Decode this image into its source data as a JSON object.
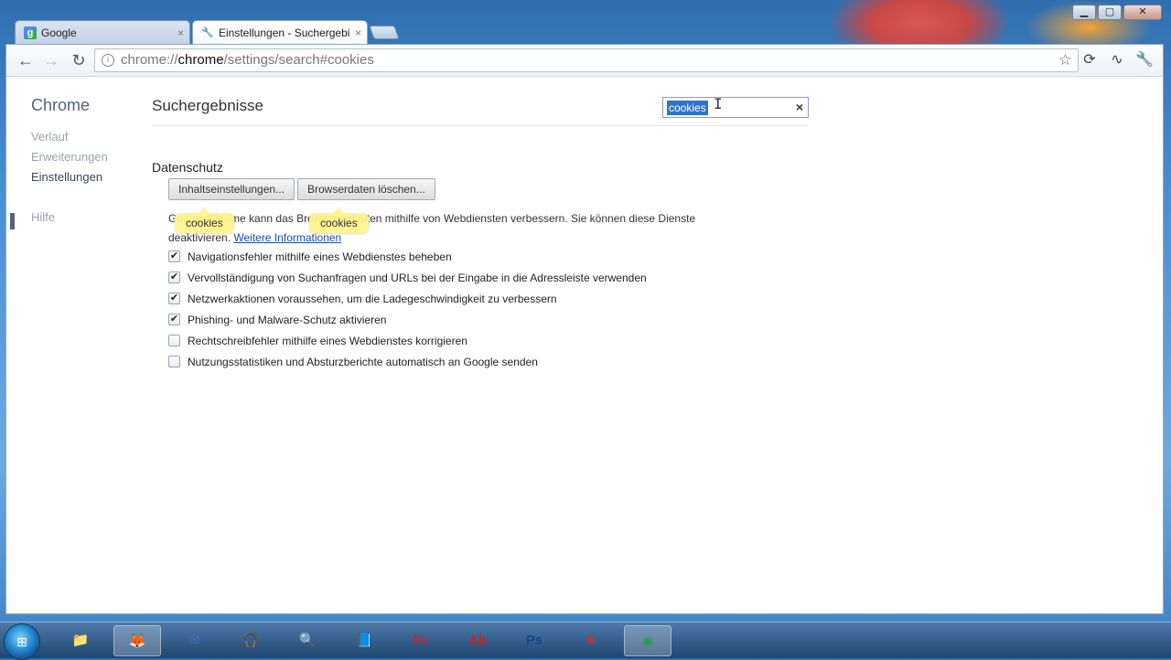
{
  "window": {
    "controls": {
      "minimize": "▁",
      "maximize": "▢",
      "close": "✕"
    }
  },
  "tabs": [
    {
      "label": "Google",
      "icon": "google-icon",
      "close": "×"
    },
    {
      "label": "Einstellungen - Suchergebi",
      "icon": "wrench-icon",
      "close": "×"
    }
  ],
  "toolbar": {
    "back": "←",
    "forward": "→",
    "reload": "↻",
    "url_scheme": "chrome://",
    "url_host": "chrome",
    "url_path": "/settings/search#cookies",
    "star": "☆",
    "ext1": "⟳",
    "ext2": "∿",
    "wrench": "🔧"
  },
  "sidebar": {
    "title": "Chrome",
    "items": [
      {
        "label": "Verlauf"
      },
      {
        "label": "Erweiterungen"
      },
      {
        "label": "Einstellungen"
      },
      {
        "label": "Hilfe"
      }
    ]
  },
  "main": {
    "title": "Suchergebnisse",
    "search": {
      "value": "cookies",
      "clear": "×"
    },
    "section": {
      "title": "Datenschutz",
      "buttons": [
        {
          "label": "Inhaltseinstellungen..."
        },
        {
          "label": "Browserdaten löschen..."
        }
      ],
      "bubbles": [
        "cookies",
        "cookies"
      ],
      "description": "Google Chrome kann das Browserverhalten mithilfe von Webdiensten verbessern. Sie können diese Dienste deaktivieren.",
      "link": "Weitere Informationen",
      "checkboxes": [
        {
          "label": "Navigationsfehler mithilfe eines Webdienstes beheben",
          "checked": true
        },
        {
          "label": "Vervollständigung von Suchanfragen und URLs bei der Eingabe in die Adressleiste verwenden",
          "checked": true
        },
        {
          "label": "Netzwerkaktionen voraussehen, um die Ladegeschwindigkeit zu verbessern",
          "checked": true
        },
        {
          "label": "Phishing- und Malware-Schutz aktivieren",
          "checked": true
        },
        {
          "label": "Rechtschreibfehler mithilfe eines Webdienstes korrigieren",
          "checked": false
        },
        {
          "label": "Nutzungsstatistiken und Absturzberichte automatisch an Google senden",
          "checked": false
        }
      ],
      "check_mark": "✔"
    }
  },
  "taskbar": {
    "items": [
      {
        "name": "explorer-icon",
        "glyph": "📁",
        "active": false
      },
      {
        "name": "firefox-icon",
        "glyph": "🦊",
        "active": true
      },
      {
        "name": "thunderbird-icon",
        "glyph": "✉",
        "active": false
      },
      {
        "name": "headphones-icon",
        "glyph": "🎧",
        "active": false
      },
      {
        "name": "search-icon",
        "glyph": "🔍",
        "active": false
      },
      {
        "name": "ebook-icon",
        "glyph": "📘",
        "active": false
      },
      {
        "name": "filezilla-icon",
        "glyph": "Fz",
        "active": false
      },
      {
        "name": "acrobat-icon",
        "glyph": "Ab",
        "active": false
      },
      {
        "name": "photoshop-icon",
        "glyph": "Ps",
        "active": false
      },
      {
        "name": "pokerstars-icon",
        "glyph": "★",
        "active": false
      },
      {
        "name": "chrome-icon",
        "glyph": "◉",
        "active": true
      }
    ],
    "colors": {
      "explorer-icon": "#f2c94c",
      "firefox-icon": "#e66a1f",
      "thunderbird-icon": "#3e6fb6",
      "headphones-icon": "#1a1a1a",
      "search-icon": "#dfe7ef",
      "ebook-icon": "#2c3e66",
      "filezilla-icon": "#c0262d",
      "acrobat-icon": "#c9211e",
      "photoshop-icon": "#0b4c8c",
      "pokerstars-icon": "#d62b2b",
      "chrome-icon": "#2d9b4a"
    }
  }
}
